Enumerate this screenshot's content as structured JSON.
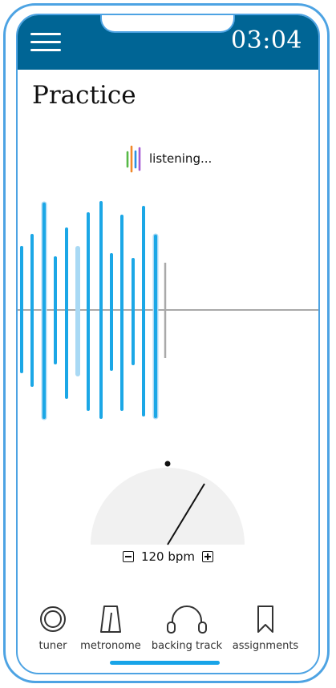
{
  "header": {
    "menu_icon": "hamburger-menu-icon",
    "clock": "03:04",
    "background": "#006595"
  },
  "page": {
    "title": "Practice"
  },
  "listening": {
    "label": "listening...",
    "icon": "audio-levels-icon",
    "icon_colors": [
      "#57b947",
      "#f1892a",
      "#2e8fe0",
      "#a55bd2"
    ]
  },
  "waveform": {
    "bar_color": "#1ba7e6",
    "highlight_color": "#a9d9f4",
    "axis_color": "#a9a9a9"
  },
  "metronome": {
    "tempo_value": "120 bpm",
    "minus_icon": "minus-icon",
    "plus_icon": "plus-icon",
    "dial_color": "#f1f1f1"
  },
  "tabs": [
    {
      "label": "tuner",
      "icon": "tuner-icon"
    },
    {
      "label": "metronome",
      "icon": "metronome-icon"
    },
    {
      "label": "backing track",
      "icon": "headphones-icon"
    },
    {
      "label": "assignments",
      "icon": "bookmark-icon"
    }
  ],
  "active_tab": "backing track",
  "colors": {
    "frame": "#4da3e3",
    "accent": "#18a4e8"
  }
}
